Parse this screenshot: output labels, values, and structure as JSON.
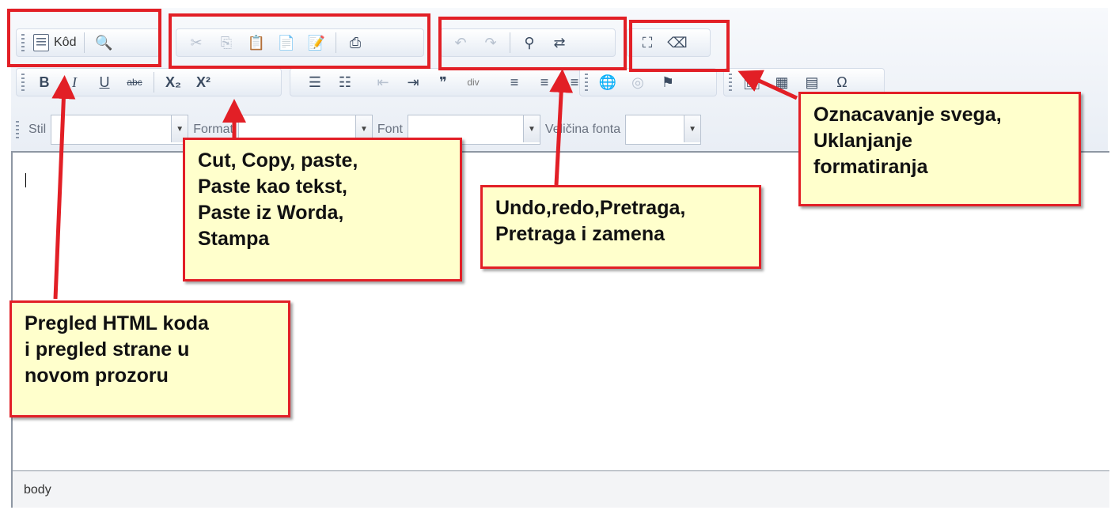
{
  "toolbar": {
    "row1": {
      "code_label": "Kôd",
      "icons": [
        "source-icon",
        "preview-icon",
        "cut-icon",
        "copy-icon",
        "paste-icon",
        "paste-text-icon",
        "paste-word-icon",
        "print-icon",
        "undo-icon",
        "redo-icon",
        "find-icon",
        "replace-icon",
        "select-all-icon",
        "remove-format-icon"
      ]
    },
    "row2": {
      "bold": "B",
      "italic": "I",
      "underline": "U",
      "strike": "abc",
      "subscript": "X₂",
      "superscript": "X²",
      "blockquote": "❞",
      "div": "div"
    },
    "row3": {
      "style_label": "Stil",
      "format_label": "Format",
      "font_label": "Font",
      "size_label": "Veličina fonta"
    }
  },
  "statusbar": {
    "path": "body"
  },
  "callouts": {
    "cut_copy": "Cut, Copy, paste,\nPaste kao tekst,\nPaste iz Worda,\nStampa",
    "undo_redo": "Undo,redo,Pretraga,\nPretraga i zamena",
    "select_all": "Oznacavanje svega,\nUklanjanje\nformatiranja",
    "html_preview": "Pregled HTML koda\ni pregled strane u\nnovom prozoru"
  },
  "colors": {
    "annotation_red": "#e21f26",
    "callout_bg": "#ffffcc"
  }
}
